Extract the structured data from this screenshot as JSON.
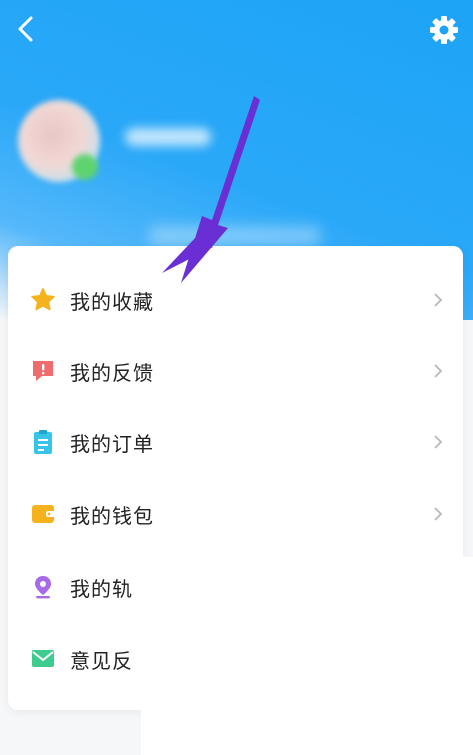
{
  "colors": {
    "header_blue": "#1da4f6",
    "arrow_purple": "#6a2fd4",
    "star": "#f5b21d",
    "feedback": "#f06b6b",
    "order": "#38c4e8",
    "wallet": "#f6b21c",
    "track": "#a76be8",
    "mail": "#3ecb8e"
  },
  "header": {
    "back_icon": "chevron-left-icon",
    "settings_icon": "gear-icon"
  },
  "menu": {
    "items": [
      {
        "label": "我的收藏",
        "icon": "star-icon",
        "has_chevron": true
      },
      {
        "label": "我的反馈",
        "icon": "feedback-icon",
        "has_chevron": true
      },
      {
        "label": "我的订单",
        "icon": "clipboard-icon",
        "has_chevron": true
      },
      {
        "label": "我的钱包",
        "icon": "wallet-icon",
        "has_chevron": true
      },
      {
        "label": "我的轨",
        "icon": "location-pin-icon",
        "has_chevron": false
      },
      {
        "label": "意见反",
        "icon": "envelope-icon",
        "has_chevron": false
      }
    ]
  }
}
